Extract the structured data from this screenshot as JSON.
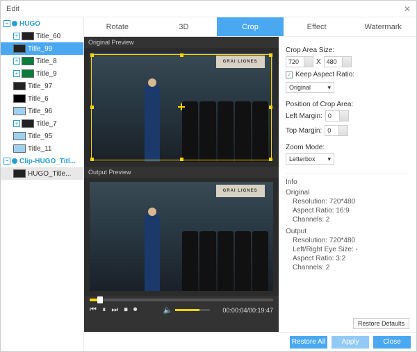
{
  "window": {
    "title": "Edit"
  },
  "sidebar": {
    "root": {
      "label": "HUGO"
    },
    "items": [
      {
        "label": "Title_60"
      },
      {
        "label": "Title_99"
      },
      {
        "label": "Title_8"
      },
      {
        "label": "Title_9"
      },
      {
        "label": "Title_97"
      },
      {
        "label": "Title_6"
      },
      {
        "label": "Title_96"
      },
      {
        "label": "Title_7"
      },
      {
        "label": "Title_95"
      },
      {
        "label": "Title_11"
      }
    ],
    "clip_root": {
      "label": "Clip-HUGO_Titl..."
    },
    "clip_items": [
      {
        "label": "HUGO_Title..."
      }
    ]
  },
  "tabs": [
    "Rotate",
    "3D",
    "Crop",
    "Effect",
    "Watermark"
  ],
  "preview": {
    "original_label": "Original Preview",
    "output_label": "Output Preview",
    "sign_text": "GRAI   LIGNES",
    "time": "00:00:04/00:19:47"
  },
  "panel": {
    "crop_size_label": "Crop Area Size:",
    "crop_w": "720",
    "crop_h": "480",
    "x_sep": "X",
    "keep_aspect_label": "Keep Aspect Ratio:",
    "aspect_select": "Original",
    "pos_label": "Position of Crop Area:",
    "left_margin_label": "Left Margin:",
    "left_margin": "0",
    "top_margin_label": "Top Margin:",
    "top_margin": "0",
    "zoom_label": "Zoom Mode:",
    "zoom_select": "Letterbox",
    "info_label": "Info",
    "original": {
      "title": "Original",
      "resolution": "Resolution: 720*480",
      "aspect": "Aspect Ratio: 16:9",
      "channels": "Channels: 2"
    },
    "output": {
      "title": "Output",
      "resolution": "Resolution: 720*480",
      "eye": "Left/Right Eye Size: -",
      "aspect": "Aspect Ratio: 3:2",
      "channels": "Channels: 2"
    },
    "restore_defaults": "Restore Defaults"
  },
  "footer": {
    "restore_all": "Restore All",
    "apply": "Apply",
    "close": "Close"
  }
}
